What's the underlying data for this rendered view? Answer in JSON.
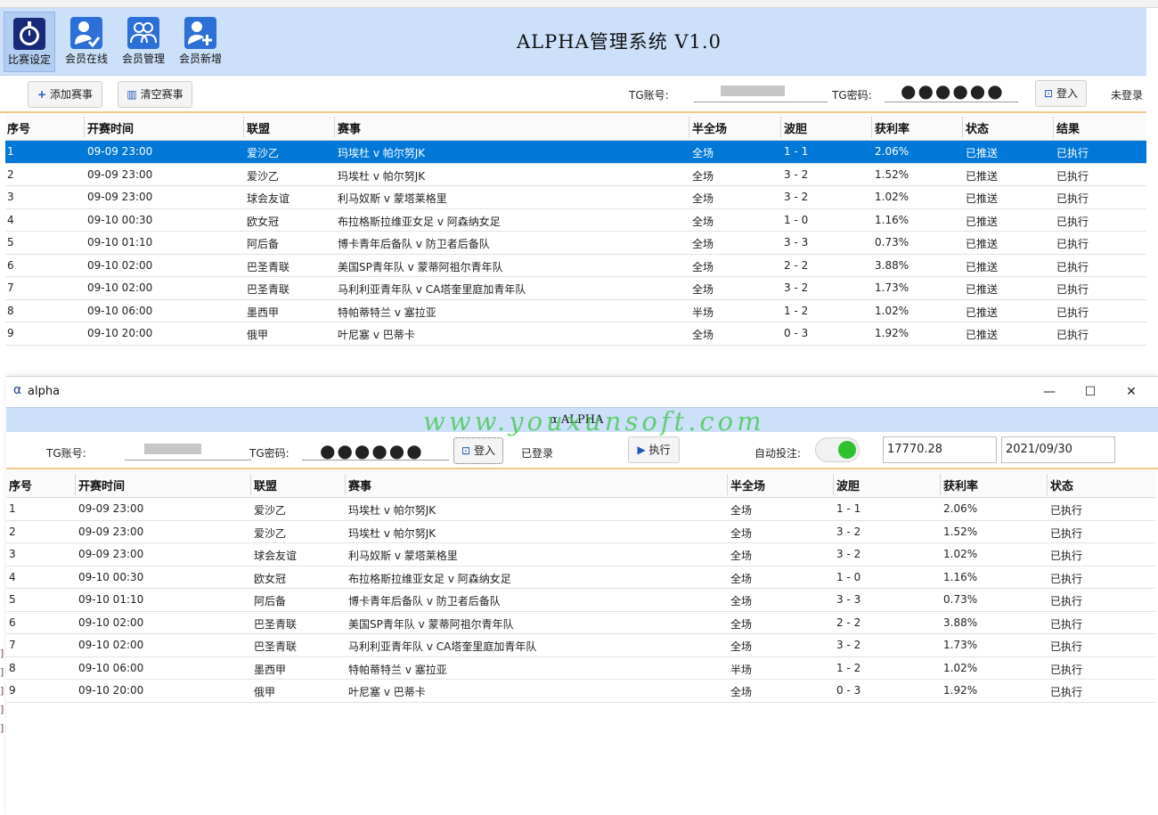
{
  "admin": {
    "title": "ALPHA管理系统 V1.0",
    "tools": [
      {
        "label": "比赛设定",
        "icon": "stopwatch-icon"
      },
      {
        "label": "会员在线",
        "icon": "user-check-icon"
      },
      {
        "label": "会员管理",
        "icon": "users-icon"
      },
      {
        "label": "会员新增",
        "icon": "user-add-icon"
      }
    ],
    "toolbar": {
      "add_label": "添加赛事",
      "clear_label": "清空赛事",
      "tg_account_label": "TG账号:",
      "tg_password_label": "TG密码:",
      "password_dots": "●●●●●●",
      "login_label": "登入",
      "status": "未登录"
    },
    "columns": [
      "序号",
      "开赛时间",
      "联盟",
      "赛事",
      "半全场",
      "波胆",
      "获利率",
      "状态",
      "结果"
    ],
    "rows": [
      {
        "no": "1",
        "time": "09-09 23:00",
        "league": "爱沙乙",
        "match": "玛埃杜 v 帕尔努JK",
        "half": "全场",
        "score": "1 - 1",
        "rate": "2.06%",
        "status": "已推送",
        "result": "已执行"
      },
      {
        "no": "2",
        "time": "09-09 23:00",
        "league": "爱沙乙",
        "match": "玛埃杜 v 帕尔努JK",
        "half": "全场",
        "score": "3 - 2",
        "rate": "1.52%",
        "status": "已推送",
        "result": "已执行"
      },
      {
        "no": "3",
        "time": "09-09 23:00",
        "league": "球会友谊",
        "match": "利马奴斯 v 蒙塔莱格里",
        "half": "全场",
        "score": "3 - 2",
        "rate": "1.02%",
        "status": "已推送",
        "result": "已执行"
      },
      {
        "no": "4",
        "time": "09-10 00:30",
        "league": "欧女冠",
        "match": "布拉格斯拉维亚女足 v 阿森纳女足",
        "half": "全场",
        "score": "1 - 0",
        "rate": "1.16%",
        "status": "已推送",
        "result": "已执行"
      },
      {
        "no": "5",
        "time": "09-10 01:10",
        "league": "阿后备",
        "match": "博卡青年后备队 v 防卫者后备队",
        "half": "全场",
        "score": "3 - 3",
        "rate": "0.73%",
        "status": "已推送",
        "result": "已执行"
      },
      {
        "no": "6",
        "time": "09-10 02:00",
        "league": "巴圣青联",
        "match": "美国SP青年队 v 蒙蒂阿祖尔青年队",
        "half": "全场",
        "score": "2 - 2",
        "rate": "3.88%",
        "status": "已推送",
        "result": "已执行"
      },
      {
        "no": "7",
        "time": "09-10 02:00",
        "league": "巴圣青联",
        "match": "马利利亚青年队 v CA塔奎里庭加青年队",
        "half": "全场",
        "score": "3 - 2",
        "rate": "1.73%",
        "status": "已推送",
        "result": "已执行"
      },
      {
        "no": "8",
        "time": "09-10 06:00",
        "league": "墨西甲",
        "match": "特帕蒂特兰 v 塞拉亚",
        "half": "半场",
        "score": "1 - 2",
        "rate": "1.02%",
        "status": "已推送",
        "result": "已执行"
      },
      {
        "no": "9",
        "time": "09-10 20:00",
        "league": "俄甲",
        "match": "叶尼塞 v 巴蒂卡",
        "half": "全场",
        "score": "0 - 3",
        "rate": "1.92%",
        "status": "已推送",
        "result": "已执行"
      }
    ]
  },
  "alpha": {
    "window_title": "alpha",
    "banner_title": "ALPHA",
    "watermark": "www.youxunsoft.com",
    "tg_account_label": "TG账号:",
    "tg_password_label": "TG密码:",
    "password_dots": "●●●●●●",
    "login_label": "登入",
    "login_status": "已登录",
    "execute_label": "执行",
    "auto_bet_label": "自动投注:",
    "balance": "17770.28",
    "date": "2021/09/30",
    "columns": [
      "序号",
      "开赛时间",
      "联盟",
      "赛事",
      "半全场",
      "波胆",
      "获利率",
      "状态"
    ],
    "rows": [
      {
        "no": "1",
        "time": "09-09 23:00",
        "league": "爱沙乙",
        "match": "玛埃杜 v 帕尔努JK",
        "half": "全场",
        "score": "1 - 1",
        "rate": "2.06%",
        "status": "已执行"
      },
      {
        "no": "2",
        "time": "09-09 23:00",
        "league": "爱沙乙",
        "match": "玛埃杜 v 帕尔努JK",
        "half": "全场",
        "score": "3 - 2",
        "rate": "1.52%",
        "status": "已执行"
      },
      {
        "no": "3",
        "time": "09-09 23:00",
        "league": "球会友谊",
        "match": "利马奴斯 v 蒙塔莱格里",
        "half": "全场",
        "score": "3 - 2",
        "rate": "1.02%",
        "status": "已执行"
      },
      {
        "no": "4",
        "time": "09-10 00:30",
        "league": "欧女冠",
        "match": "布拉格斯拉维亚女足 v 阿森纳女足",
        "half": "全场",
        "score": "1 - 0",
        "rate": "1.16%",
        "status": "已执行"
      },
      {
        "no": "5",
        "time": "09-10 01:10",
        "league": "阿后备",
        "match": "博卡青年后备队 v 防卫者后备队",
        "half": "全场",
        "score": "3 - 3",
        "rate": "0.73%",
        "status": "已执行"
      },
      {
        "no": "6",
        "time": "09-10 02:00",
        "league": "巴圣青联",
        "match": "美国SP青年队 v 蒙蒂阿祖尔青年队",
        "half": "全场",
        "score": "2 - 2",
        "rate": "3.88%",
        "status": "已执行"
      },
      {
        "no": "7",
        "time": "09-10 02:00",
        "league": "巴圣青联",
        "match": "马利利亚青年队 v CA塔奎里庭加青年队",
        "half": "全场",
        "score": "3 - 2",
        "rate": "1.73%",
        "status": "已执行"
      },
      {
        "no": "8",
        "time": "09-10 06:00",
        "league": "墨西甲",
        "match": "特帕蒂特兰 v 塞拉亚",
        "half": "半场",
        "score": "1 - 2",
        "rate": "1.02%",
        "status": "已执行"
      },
      {
        "no": "9",
        "time": "09-10 20:00",
        "league": "俄甲",
        "match": "叶尼塞 v 巴蒂卡",
        "half": "全场",
        "score": "0 - 3",
        "rate": "1.92%",
        "status": "已执行"
      }
    ]
  },
  "colors": {
    "header_bg": "#cce0fa",
    "selected_row": "#0078d7",
    "toggle_on": "#2dc22d",
    "separator": "#f0c88a",
    "watermark": "#46c850"
  }
}
